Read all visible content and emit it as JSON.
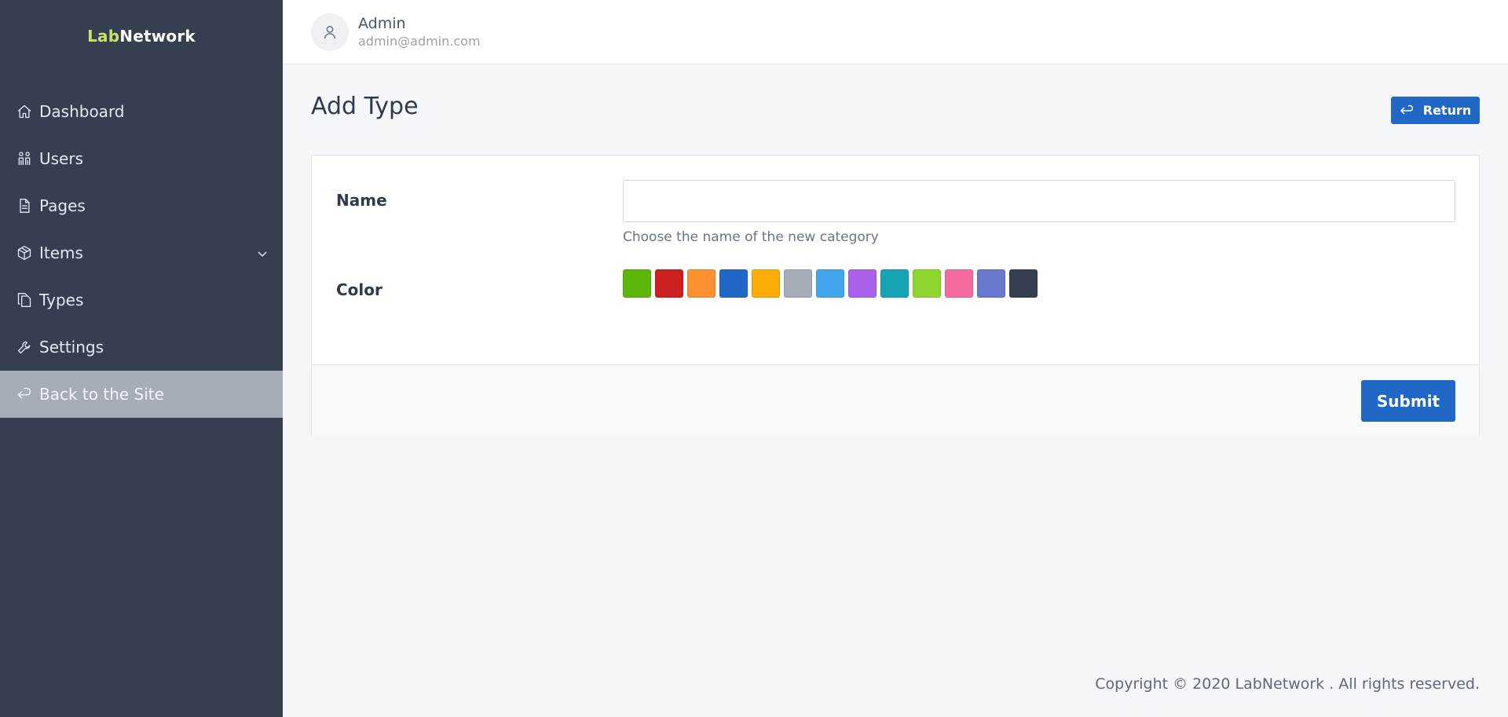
{
  "brand": {
    "part1": "Lab",
    "part2": "Network"
  },
  "sidebar": {
    "items": [
      {
        "label": "Dashboard",
        "icon": "home-icon"
      },
      {
        "label": "Users",
        "icon": "users-icon"
      },
      {
        "label": "Pages",
        "icon": "document-icon"
      },
      {
        "label": "Items",
        "icon": "box-icon"
      },
      {
        "label": "Types",
        "icon": "copy-icon"
      },
      {
        "label": "Settings",
        "icon": "wrench-icon"
      },
      {
        "label": "Back to the Site",
        "icon": "return-icon"
      }
    ]
  },
  "header": {
    "user_name": "Admin",
    "user_email": "admin@admin.com"
  },
  "main": {
    "title": "Add Type",
    "return_label": "Return",
    "form": {
      "name_label": "Name",
      "name_value": "",
      "name_hint": "Choose the name of the new category",
      "color_label": "Color",
      "colors": [
        "#5db60a",
        "#cd2020",
        "#fd912f",
        "#2167c6",
        "#fdac0a",
        "#a6adb9",
        "#44a5ef",
        "#a861e8",
        "#17a5b6",
        "#8fd52f",
        "#f56b9d",
        "#6b78d0",
        "#353f50"
      ],
      "submit_label": "Submit"
    }
  },
  "footer": {
    "copyright": "Copyright © 2020 LabNetwork . All rights reserved."
  },
  "colors": {
    "sidebar_bg": "#353f50",
    "accent": "#2167c6",
    "brand_accent": "#c8e26a"
  }
}
